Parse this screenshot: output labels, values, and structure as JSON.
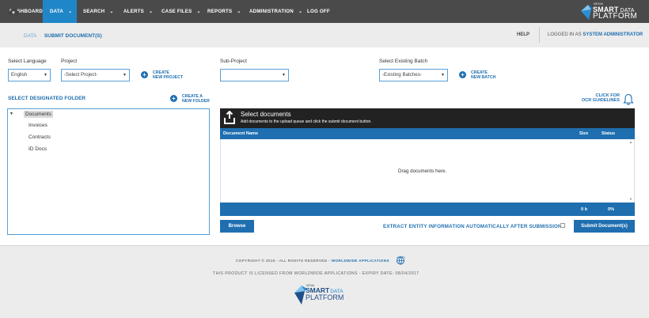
{
  "nav": {
    "items": [
      {
        "label": "DASHBOARD",
        "chevron": false
      },
      {
        "label": "DATA",
        "chevron": true,
        "active": true
      },
      {
        "label": "SEARCH",
        "chevron": true
      },
      {
        "label": "ALERTS",
        "chevron": true
      },
      {
        "label": "CASE FILES",
        "chevron": true
      },
      {
        "label": "REPORTS",
        "chevron": true
      },
      {
        "label": "ADMINISTRATION",
        "chevron": true
      },
      {
        "label": "LOG OFF",
        "chevron": false
      }
    ],
    "brand_small": "NEXIA",
    "brand_line1": "SMART",
    "brand_line1b": "DATA",
    "brand_line2": "PLATFORM"
  },
  "subheader": {
    "crumb_parent": "DATA",
    "crumb_sep": "-",
    "crumb_current": "SUBMIT DOCUMENT(S)",
    "help": "HELP",
    "logged_prefix": "LOGGED IN AS",
    "logged_user": "SYSTEM ADMINISTRATOR"
  },
  "form": {
    "language_label": "Select Language",
    "language_value": "English",
    "project_label": "Project",
    "project_value": "-Select Project-",
    "create_project_1": "CREATE",
    "create_project_2": "NEW PROJECT",
    "subproject_label": "Sub-Project",
    "subproject_value": "",
    "batch_label": "Select Existing Batch",
    "batch_value": "-Existing Batches-",
    "create_batch_1": "CREATE",
    "create_batch_2": "NEW BATCH"
  },
  "folders": {
    "title": "SELECT DESIGNATED FOLDER",
    "create_1": "CREATE A",
    "create_2": "NEW FOLDER",
    "root": "Documents",
    "children": [
      "Invoices",
      "Contracts",
      "ID Docs"
    ]
  },
  "upload": {
    "ocr_1": "CLICK FOR",
    "ocr_2": "OCR GUIDELINES",
    "title": "Select documents",
    "subtitle": "Add documents to the upload queue and click the submit document button.",
    "col_name": "Document Name",
    "col_size": "Size",
    "col_status": "Status",
    "drop_text": "Drag documents here.",
    "total_size": "0 b",
    "total_status": "0%",
    "browse": "Browse",
    "extract_label": "EXTRACT ENTITY INFORMATION AUTOMATICALLY AFTER SUBMISSION",
    "extract_checked": false,
    "submit": "Submit Document(s)"
  },
  "footer": {
    "copyright": "COPYRIGHT © 2016 - ALL RIGHTS RESERVED -",
    "company": "WORLDWIDE APPLICATIONS",
    "license": "THIS PRODUCT IS LICENSED FROM WORLDWIDE APPLICATIONS - EXPIRY DATE: 08/04/2017",
    "logo_small": "NEXIA",
    "logo_line1": "SMART",
    "logo_line1b": "DATA",
    "logo_line2": "PLATFORM"
  },
  "colors": {
    "nav_bg": "#4a4a4a",
    "accent": "#1f6fb0",
    "active_tab": "#1f86c8"
  }
}
